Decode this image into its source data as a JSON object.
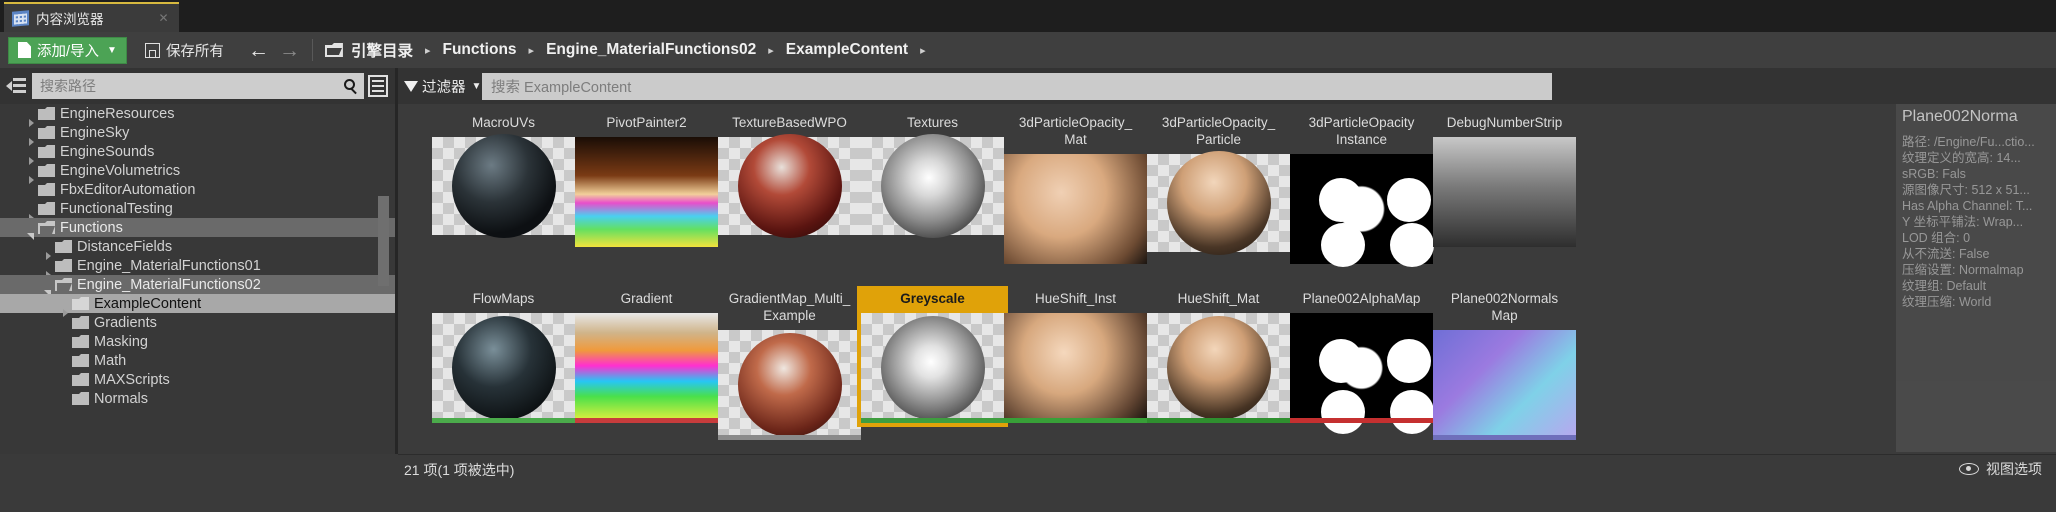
{
  "window": {
    "tab_label": "内容浏览器",
    "tab_icon": "content-browser-icon",
    "close_glyph": "✕"
  },
  "toolbar": {
    "add_import_label": "添加/导入",
    "add_caret": "▼",
    "save_all_label": "保存所有",
    "back_glyph": "←",
    "forward_glyph": "→",
    "breadcrumb": [
      {
        "label": "引擎目录",
        "sep": "▸"
      },
      {
        "label": "Functions",
        "sep": "▸"
      },
      {
        "label": "Engine_MaterialFunctions02",
        "sep": "▸"
      },
      {
        "label": "ExampleContent",
        "sep": "▸"
      }
    ]
  },
  "search": {
    "path_placeholder": "搜索路径",
    "asset_placeholder": "搜索 ExampleContent",
    "filter_label": "过滤器",
    "filter_caret": "▼"
  },
  "sidebar": {
    "items": [
      {
        "label": "EngineResources",
        "depth": 1,
        "state": "closed",
        "selected": "none"
      },
      {
        "label": "EngineSky",
        "depth": 1,
        "state": "closed",
        "selected": "none"
      },
      {
        "label": "EngineSounds",
        "depth": 1,
        "state": "closed",
        "selected": "none"
      },
      {
        "label": "EngineVolumetrics",
        "depth": 1,
        "state": "closed",
        "selected": "none"
      },
      {
        "label": "FbxEditorAutomation",
        "depth": 1,
        "state": "leaf",
        "selected": "none"
      },
      {
        "label": "FunctionalTesting",
        "depth": 1,
        "state": "closed",
        "selected": "none"
      },
      {
        "label": "Functions",
        "depth": 1,
        "state": "open",
        "selected": "mid"
      },
      {
        "label": "DistanceFields",
        "depth": 2,
        "state": "closed",
        "selected": "none"
      },
      {
        "label": "Engine_MaterialFunctions01",
        "depth": 2,
        "state": "closed",
        "selected": "none"
      },
      {
        "label": "Engine_MaterialFunctions02",
        "depth": 2,
        "state": "open",
        "selected": "mid"
      },
      {
        "label": "ExampleContent",
        "depth": 3,
        "state": "closed",
        "selected": "strong"
      },
      {
        "label": "Gradients",
        "depth": 3,
        "state": "leaf",
        "selected": "none"
      },
      {
        "label": "Masking",
        "depth": 3,
        "state": "leaf",
        "selected": "none"
      },
      {
        "label": "Math",
        "depth": 3,
        "state": "leaf",
        "selected": "none"
      },
      {
        "label": "MAXScripts",
        "depth": 3,
        "state": "leaf",
        "selected": "none"
      },
      {
        "label": "Normals",
        "depth": 3,
        "state": "leaf",
        "selected": "none"
      }
    ]
  },
  "grid": {
    "row1": [
      {
        "label": "MacroUVs"
      },
      {
        "label": "PivotPainter2"
      },
      {
        "label": "TextureBasedWPO"
      },
      {
        "label": "Textures"
      },
      {
        "label": "3dParticleOpacity_\nMat"
      },
      {
        "label": "3dParticleOpacity_\nParticle"
      },
      {
        "label": "3dParticleOpacity\nInstance"
      },
      {
        "label": "DebugNumberStrip"
      }
    ],
    "row2": [
      {
        "label": "FlowMaps",
        "bar": "#4bab4b",
        "selected": false
      },
      {
        "label": "Gradient",
        "bar": "#c73c3c",
        "selected": false
      },
      {
        "label": "GradientMap_Multi_\nExample",
        "bar": "#8a8a8a",
        "selected": false
      },
      {
        "label": "Greyscale",
        "bar": "#3f9d3f",
        "selected": true
      },
      {
        "label": "HueShift_Inst",
        "bar": "#38a038",
        "selected": false
      },
      {
        "label": "HueShift_Mat",
        "bar": "#2f8f2f",
        "selected": false
      },
      {
        "label": "Plane002AlphaMap",
        "bar": "#c53030",
        "selected": false
      },
      {
        "label": "Plane002Normals\nMap",
        "bar": "#6f6fbb",
        "selected": false
      }
    ]
  },
  "tooltip": {
    "title": "Plane002Norma",
    "lines": [
      "路径: /Engine/Fu...ctio...",
      "纹理定义的宽高: 14...",
      "sRGB: Fals",
      "源图像尺寸: 512 x 51...",
      "Has Alpha Channel: T...",
      "Y 坐标平铺法: Wrap...",
      "LOD 组合: 0",
      "从不流送: False",
      "压缩设置: Normalmap",
      "纹理组: Default",
      "纹理压缩: World"
    ]
  },
  "status": {
    "items_text": "21 项(1 项被选中)",
    "view_options_label": "视图选项",
    "eye_icon": "eye-icon"
  },
  "colors": {
    "accent_selected": "#e0a209",
    "tab_accent": "#d7b93f",
    "add_button": "#4ca355"
  }
}
